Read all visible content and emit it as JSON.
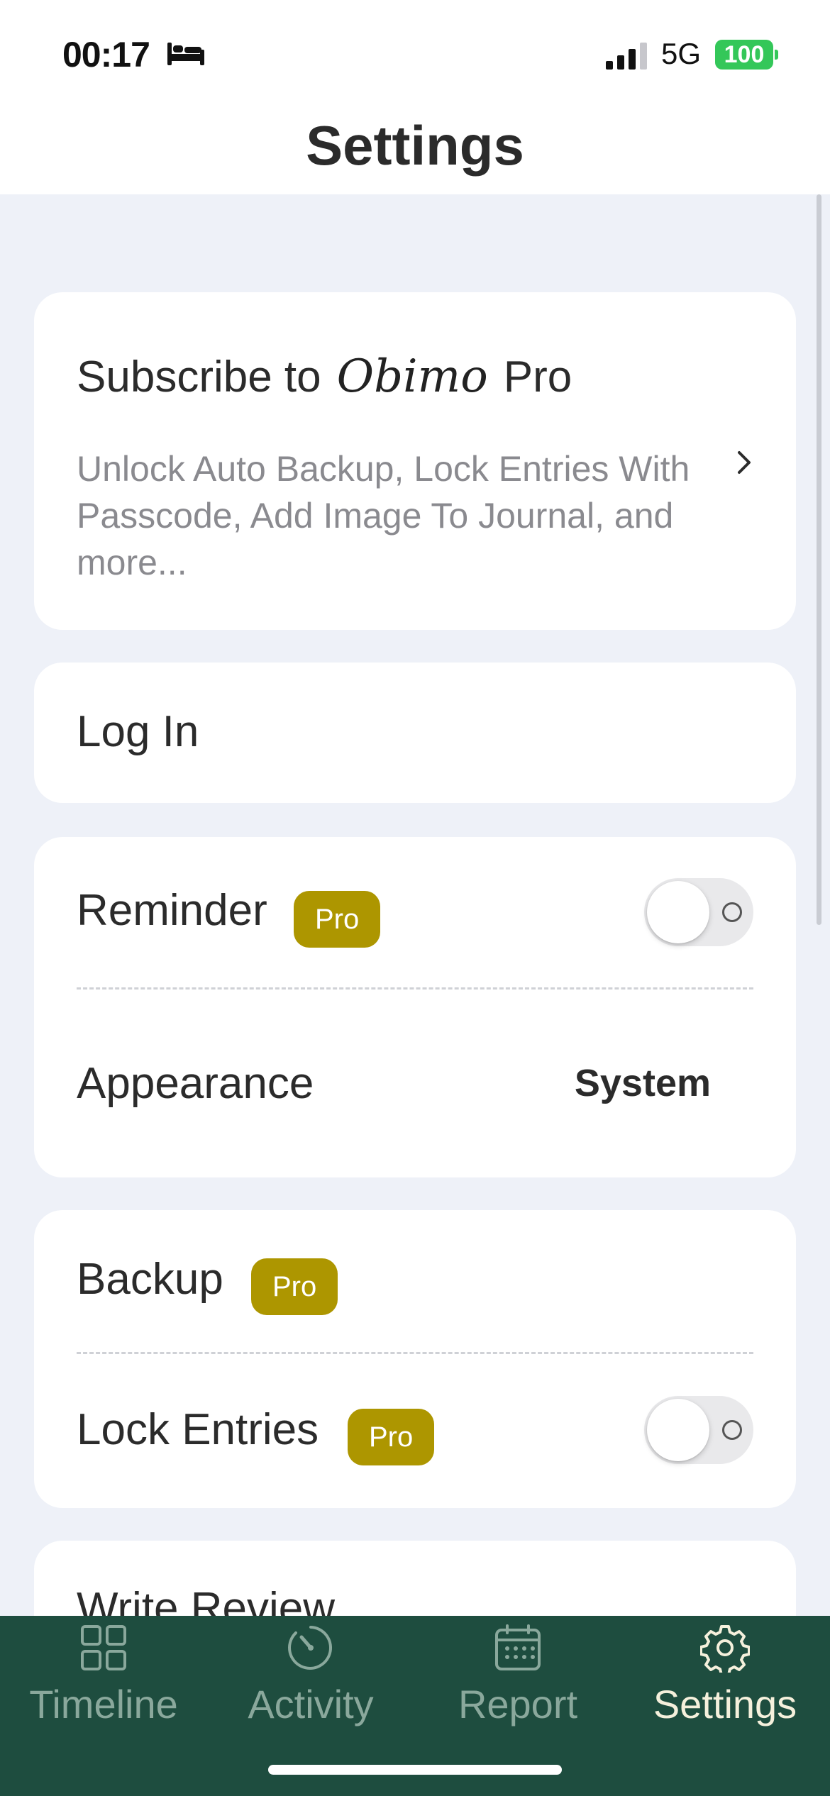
{
  "status_bar": {
    "time": "00:17",
    "network": "5G",
    "battery": "100"
  },
  "header": {
    "title": "Settings"
  },
  "subscribe_card": {
    "prefix": "Subscribe to",
    "brand": "Obimo",
    "suffix": "Pro",
    "description": "Unlock Auto Backup, Lock Entries With Passcode, Add Image To Journal, and more..."
  },
  "login": {
    "label": "Log In"
  },
  "preferences": {
    "reminder_label": "Reminder",
    "reminder_badge": "Pro",
    "reminder_enabled": false,
    "appearance_label": "Appearance",
    "appearance_value": "System"
  },
  "data_section": {
    "backup_label": "Backup",
    "backup_badge": "Pro",
    "lock_label": "Lock Entries",
    "lock_badge": "Pro",
    "lock_enabled": false
  },
  "more": {
    "review_label": "Write Review"
  },
  "tab_bar": {
    "tabs": [
      {
        "label": "Timeline",
        "icon": "grid-icon",
        "active": false
      },
      {
        "label": "Activity",
        "icon": "gauge-icon",
        "active": false
      },
      {
        "label": "Report",
        "icon": "calendar-icon",
        "active": false
      },
      {
        "label": "Settings",
        "icon": "gear-icon",
        "active": true
      }
    ]
  },
  "colors": {
    "pro_badge": "#ad9600",
    "tab_bar_bg": "#1e4d3f",
    "tab_active": "#f5f0dc",
    "tab_inactive": "#8aa89c",
    "page_bg": "#eef1f8"
  }
}
